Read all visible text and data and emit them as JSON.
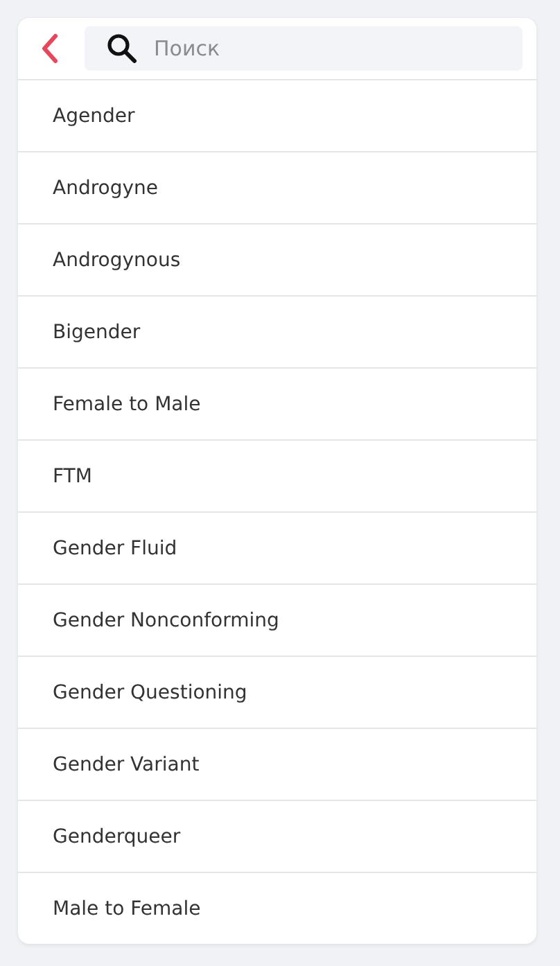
{
  "search": {
    "placeholder": "Поиск"
  },
  "items": [
    {
      "label": "Agender"
    },
    {
      "label": "Androgyne"
    },
    {
      "label": "Androgynous"
    },
    {
      "label": "Bigender"
    },
    {
      "label": "Female to Male"
    },
    {
      "label": "FTM"
    },
    {
      "label": "Gender Fluid"
    },
    {
      "label": "Gender Nonconforming"
    },
    {
      "label": "Gender Questioning"
    },
    {
      "label": "Gender Variant"
    },
    {
      "label": "Genderqueer"
    },
    {
      "label": "Male to Female"
    }
  ]
}
